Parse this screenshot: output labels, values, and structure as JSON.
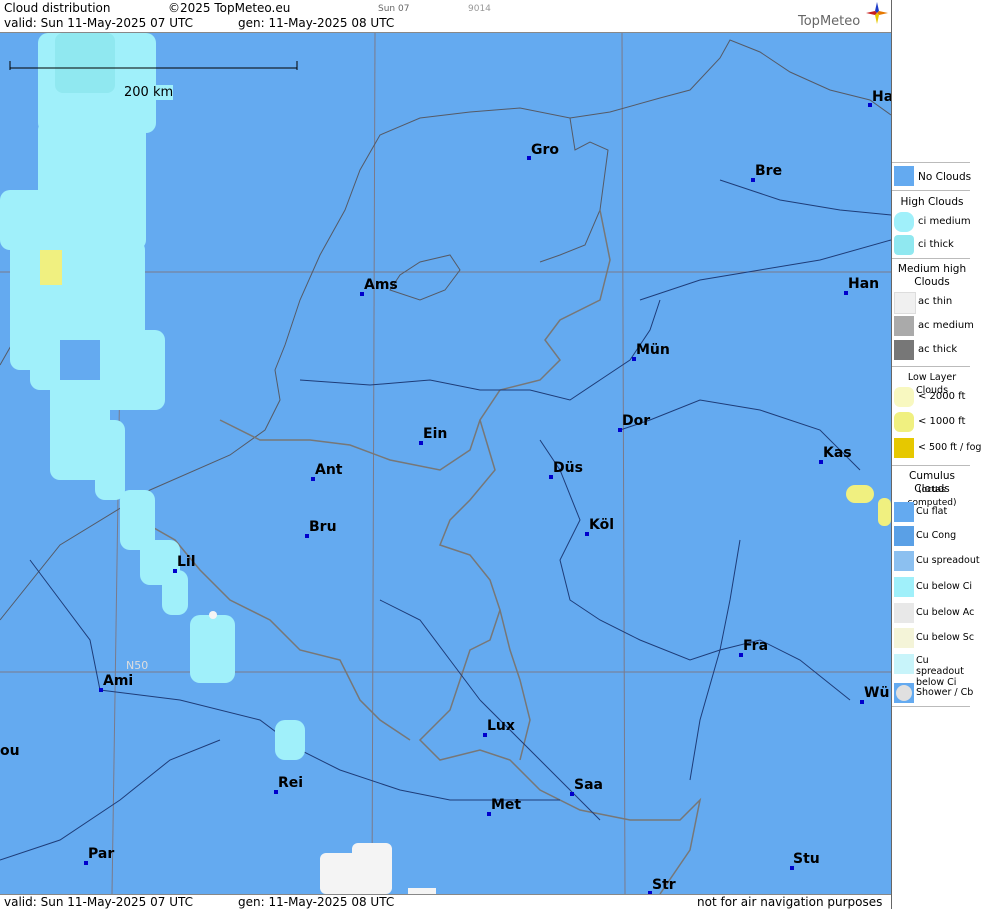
{
  "header": {
    "title": "Cloud distribution",
    "copyright": "©2025 TopMeteo.eu",
    "day_label": "Sun 07",
    "code": "9014",
    "valid": "valid:  Sun  11-May-2025  07 UTC",
    "generated": "gen: 11-May-2025 08 UTC",
    "logo": "TopMeteo"
  },
  "scale_bar": "200 km",
  "latitude_label": "N50",
  "cities": [
    {
      "name": "Gro"
    },
    {
      "name": "Bre"
    },
    {
      "name": "Ha"
    },
    {
      "name": "Ams"
    },
    {
      "name": "Han"
    },
    {
      "name": "Mün"
    },
    {
      "name": "Dor"
    },
    {
      "name": "Ein"
    },
    {
      "name": "Kas"
    },
    {
      "name": "Ant"
    },
    {
      "name": "Düs"
    },
    {
      "name": "Bru"
    },
    {
      "name": "Köl"
    },
    {
      "name": "Lil"
    },
    {
      "name": "Fra"
    },
    {
      "name": "Ami"
    },
    {
      "name": "Wü"
    },
    {
      "name": "Lux"
    },
    {
      "name": "ou"
    },
    {
      "name": "Rei"
    },
    {
      "name": "Saa"
    },
    {
      "name": "Met"
    },
    {
      "name": "Par"
    },
    {
      "name": "Stu"
    },
    {
      "name": "Str"
    }
  ],
  "footer": {
    "valid": "valid:  Sun  11-May-2025  07 UTC",
    "generated": "gen: 11-May-2025 08 UTC",
    "disclaimer": "not for air navigation purposes"
  },
  "legend": {
    "no_clouds": "No Clouds",
    "high_title": "High Clouds",
    "high": [
      "ci medium",
      "ci thick"
    ],
    "medium_title": "Medium high Clouds",
    "medium": [
      "ac thin",
      "ac medium",
      "ac thick"
    ],
    "low_title": "Low Layer Clouds",
    "low": [
      "< 2000 ft",
      "< 1000 ft",
      "< 500 ft / fog"
    ],
    "cumulus_title": "Cumulus Clouds",
    "cumulus_sub": "(octas computed)",
    "cumulus": [
      "Cu flat",
      "Cu Cong",
      "Cu spreadout",
      "Cu below Ci",
      "Cu below Ac",
      "Cu below Sc",
      "Cu spreadout below Ci",
      "Shower / Cb"
    ]
  },
  "colors": {
    "no_clouds": "#64aaf0",
    "ci_medium": "#a0f0fa",
    "ci_thick": "#90e8f0",
    "low": "#f0f080",
    "fog": "#e6c800",
    "border": "#777777",
    "river": "#1e3c78"
  }
}
